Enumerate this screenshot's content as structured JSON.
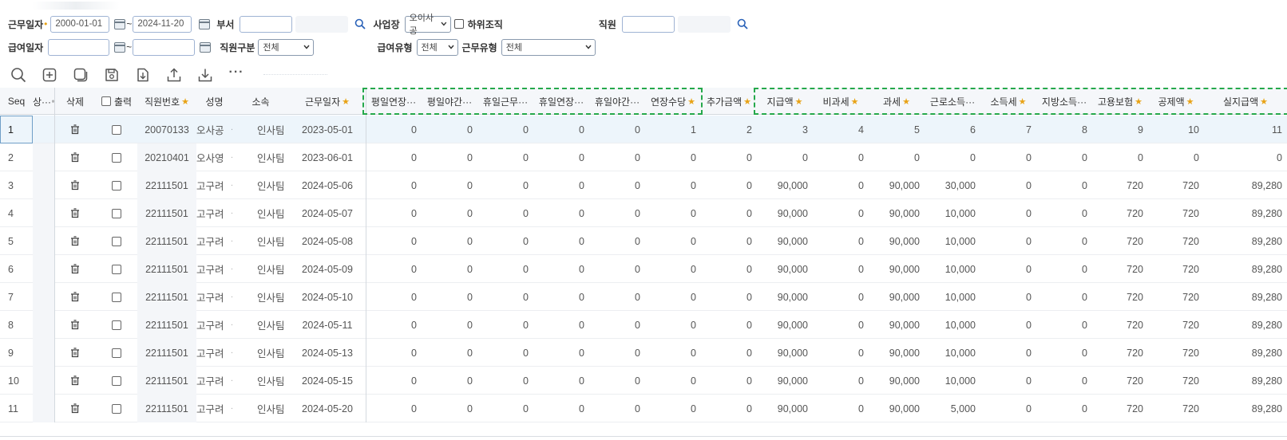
{
  "filters": {
    "work_date_label": "근무일자",
    "work_date_from": "2000-01-01",
    "work_date_to": "2024-11-20",
    "dept_label": "부서",
    "site_label": "사업장",
    "site_value": "오이사공",
    "sub_org_label": "하위조직",
    "employee_label": "직원",
    "pay_date_label": "급여일자",
    "emp_type_label": "직원구분",
    "emp_type_value": "전체",
    "pay_type_label": "급여유형",
    "pay_type_value": "전체",
    "work_type_label": "근무유형",
    "work_type_value": "전체"
  },
  "toolbar": {
    "items": [
      "search-icon",
      "add-icon",
      "copy-icon",
      "save-icon",
      "download-file-icon",
      "upload-icon",
      "export-icon",
      "more-icon"
    ],
    "more_label": "···"
  },
  "columns": [
    {
      "key": "seq",
      "label": "Seq"
    },
    {
      "key": "status",
      "label": "상···"
    },
    {
      "key": "delete",
      "label": "삭제"
    },
    {
      "key": "print",
      "label": "출력"
    },
    {
      "key": "emp_no",
      "label": "직원번호",
      "star": true
    },
    {
      "key": "name",
      "label": "성명"
    },
    {
      "key": "dept",
      "label": "소속"
    },
    {
      "key": "work_date",
      "label": "근무일자",
      "star": true
    },
    {
      "key": "c1",
      "label": "평일연장···"
    },
    {
      "key": "c2",
      "label": "평일야간···"
    },
    {
      "key": "c3",
      "label": "휴일근무···"
    },
    {
      "key": "c4",
      "label": "휴일연장···"
    },
    {
      "key": "c5",
      "label": "휴일야간···"
    },
    {
      "key": "c6",
      "label": "연장수당",
      "star": true
    },
    {
      "key": "c7",
      "label": "추가금액",
      "star": true
    },
    {
      "key": "c8",
      "label": "지급액",
      "star": true
    },
    {
      "key": "c9",
      "label": "비과세",
      "star": true
    },
    {
      "key": "c10",
      "label": "과세",
      "star": true
    },
    {
      "key": "c11",
      "label": "근로소득···"
    },
    {
      "key": "c12",
      "label": "소득세",
      "star": true
    },
    {
      "key": "c13",
      "label": "지방소득···"
    },
    {
      "key": "c14",
      "label": "고용보험",
      "star": true
    },
    {
      "key": "c15",
      "label": "공제액",
      "star": true
    },
    {
      "key": "c16",
      "label": "실지급액",
      "star": true
    }
  ],
  "star_glyph": "★",
  "rows": [
    {
      "seq": "1",
      "emp_no": "20070133",
      "name": "오사공",
      "dept": "인사팀",
      "work_date": "2023-05-01",
      "vals": [
        "0",
        "0",
        "0",
        "0",
        "0",
        "1",
        "2",
        "3",
        "4",
        "5",
        "6",
        "7",
        "8",
        "9",
        "10",
        "11"
      ]
    },
    {
      "seq": "2",
      "emp_no": "20210401",
      "name": "오사영",
      "dept": "인사팀",
      "work_date": "2023-06-01",
      "vals": [
        "0",
        "0",
        "0",
        "0",
        "0",
        "0",
        "0",
        "0",
        "0",
        "0",
        "0",
        "0",
        "0",
        "0",
        "0",
        "0"
      ]
    },
    {
      "seq": "3",
      "emp_no": "22111501",
      "name": "고구려",
      "dept": "인사팀",
      "work_date": "2024-05-06",
      "vals": [
        "0",
        "0",
        "0",
        "0",
        "0",
        "0",
        "0",
        "90,000",
        "0",
        "90,000",
        "30,000",
        "0",
        "0",
        "720",
        "720",
        "89,280"
      ]
    },
    {
      "seq": "4",
      "emp_no": "22111501",
      "name": "고구려",
      "dept": "인사팀",
      "work_date": "2024-05-07",
      "vals": [
        "0",
        "0",
        "0",
        "0",
        "0",
        "0",
        "0",
        "90,000",
        "0",
        "90,000",
        "10,000",
        "0",
        "0",
        "720",
        "720",
        "89,280"
      ]
    },
    {
      "seq": "5",
      "emp_no": "22111501",
      "name": "고구려",
      "dept": "인사팀",
      "work_date": "2024-05-08",
      "vals": [
        "0",
        "0",
        "0",
        "0",
        "0",
        "0",
        "0",
        "90,000",
        "0",
        "90,000",
        "10,000",
        "0",
        "0",
        "720",
        "720",
        "89,280"
      ]
    },
    {
      "seq": "6",
      "emp_no": "22111501",
      "name": "고구려",
      "dept": "인사팀",
      "work_date": "2024-05-09",
      "vals": [
        "0",
        "0",
        "0",
        "0",
        "0",
        "0",
        "0",
        "90,000",
        "0",
        "90,000",
        "10,000",
        "0",
        "0",
        "720",
        "720",
        "89,280"
      ]
    },
    {
      "seq": "7",
      "emp_no": "22111501",
      "name": "고구려",
      "dept": "인사팀",
      "work_date": "2024-05-10",
      "vals": [
        "0",
        "0",
        "0",
        "0",
        "0",
        "0",
        "0",
        "90,000",
        "0",
        "90,000",
        "10,000",
        "0",
        "0",
        "720",
        "720",
        "89,280"
      ]
    },
    {
      "seq": "8",
      "emp_no": "22111501",
      "name": "고구려",
      "dept": "인사팀",
      "work_date": "2024-05-11",
      "vals": [
        "0",
        "0",
        "0",
        "0",
        "0",
        "0",
        "0",
        "90,000",
        "0",
        "90,000",
        "10,000",
        "0",
        "0",
        "720",
        "720",
        "89,280"
      ]
    },
    {
      "seq": "9",
      "emp_no": "22111501",
      "name": "고구려",
      "dept": "인사팀",
      "work_date": "2024-05-13",
      "vals": [
        "0",
        "0",
        "0",
        "0",
        "0",
        "0",
        "0",
        "90,000",
        "0",
        "90,000",
        "10,000",
        "0",
        "0",
        "720",
        "720",
        "89,280"
      ]
    },
    {
      "seq": "10",
      "emp_no": "22111501",
      "name": "고구려",
      "dept": "인사팀",
      "work_date": "2024-05-15",
      "vals": [
        "0",
        "0",
        "0",
        "0",
        "0",
        "0",
        "0",
        "90,000",
        "0",
        "90,000",
        "10,000",
        "0",
        "0",
        "720",
        "720",
        "89,280"
      ]
    },
    {
      "seq": "11",
      "emp_no": "22111501",
      "name": "고구려",
      "dept": "인사팀",
      "work_date": "2024-05-20",
      "vals": [
        "0",
        "0",
        "0",
        "0",
        "0",
        "0",
        "0",
        "90,000",
        "0",
        "90,000",
        "5,000",
        "0",
        "0",
        "720",
        "720",
        "89,280"
      ]
    }
  ],
  "colors": {
    "accent": "#25a84b",
    "star": "#e8a316",
    "selected_row": "#edf5fb"
  }
}
